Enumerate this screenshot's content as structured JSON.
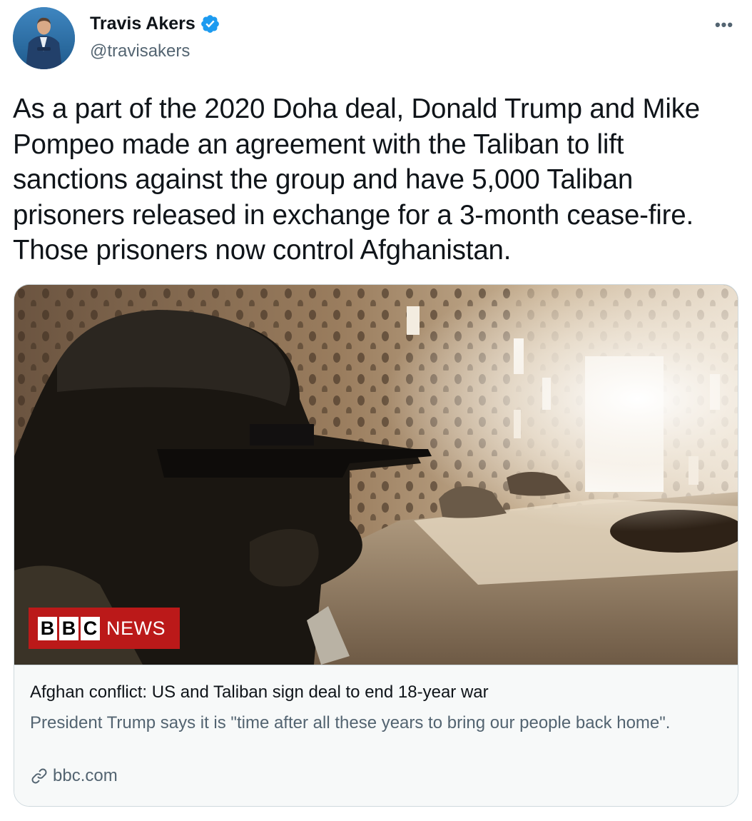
{
  "author": {
    "display_name": "Travis Akers",
    "handle": "@travisakers",
    "verified": true,
    "avatar_icon": "profile-photo"
  },
  "menu": {
    "more_label": "•••"
  },
  "tweet": {
    "text": "As a part of the 2020 Doha deal, Donald Trump and Mike Pompeo made an agreement with the Taliban to lift sanctions against the group and have 5,000 Taliban prisoners released in exchange for a 3-month cease-fire. Those prisoners now control Afghanistan."
  },
  "card": {
    "badge": {
      "letters": [
        "B",
        "B",
        "C"
      ],
      "word": "NEWS"
    },
    "title": "Afghan conflict: US and Taliban sign deal to end 18-year war",
    "description": "President Trump says it is \"time after all these years to bring our people back home\".",
    "domain": "bbc.com",
    "domain_icon": "link-icon"
  },
  "colors": {
    "verified_blue": "#1d9bf0",
    "bbc_red": "#bb1919",
    "secondary_text": "#536471",
    "border": "#cfd9de"
  }
}
